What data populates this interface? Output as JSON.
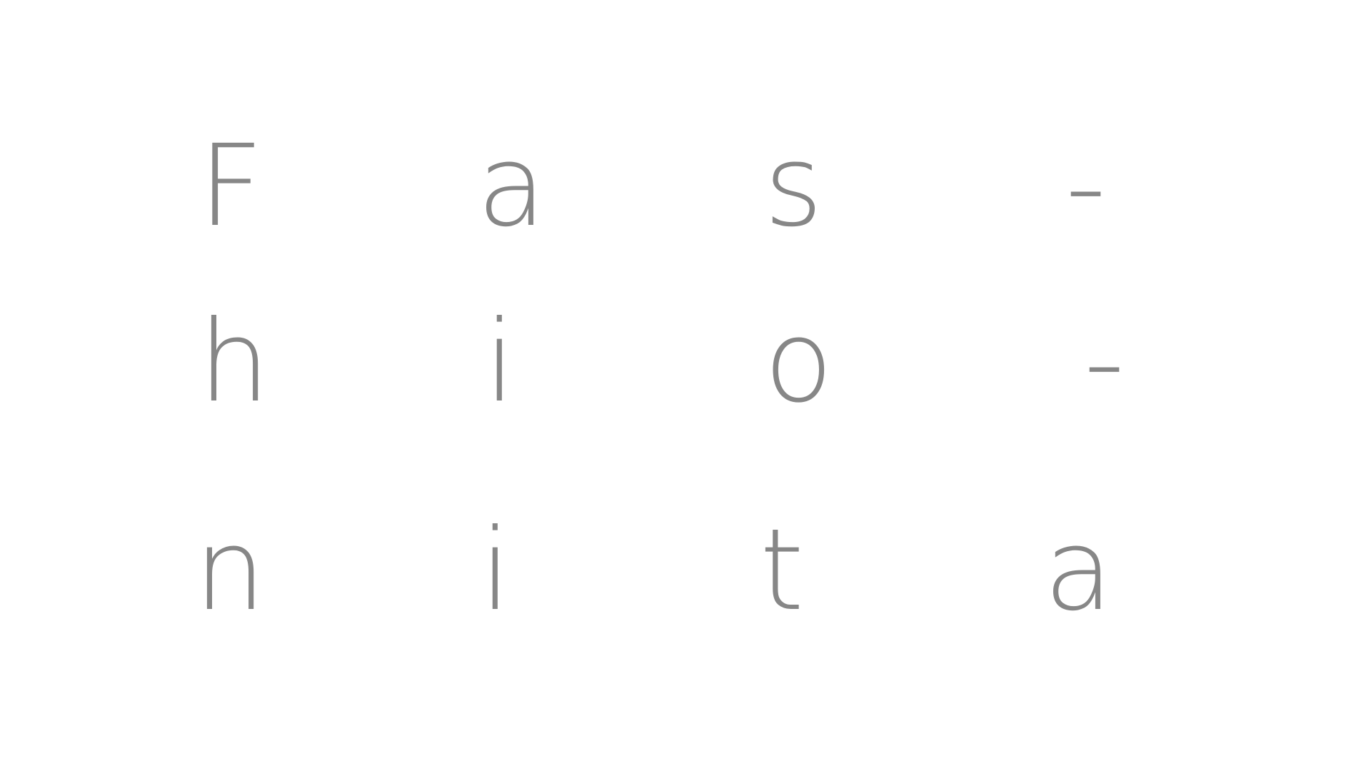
{
  "colors": {
    "background": "#ffffff",
    "letters": "#878787"
  },
  "grid": {
    "rows": [
      [
        "F",
        "a",
        "s",
        "-"
      ],
      [
        "h",
        "i",
        "o",
        "-"
      ],
      [
        "n",
        "i",
        "t",
        "a"
      ]
    ]
  }
}
